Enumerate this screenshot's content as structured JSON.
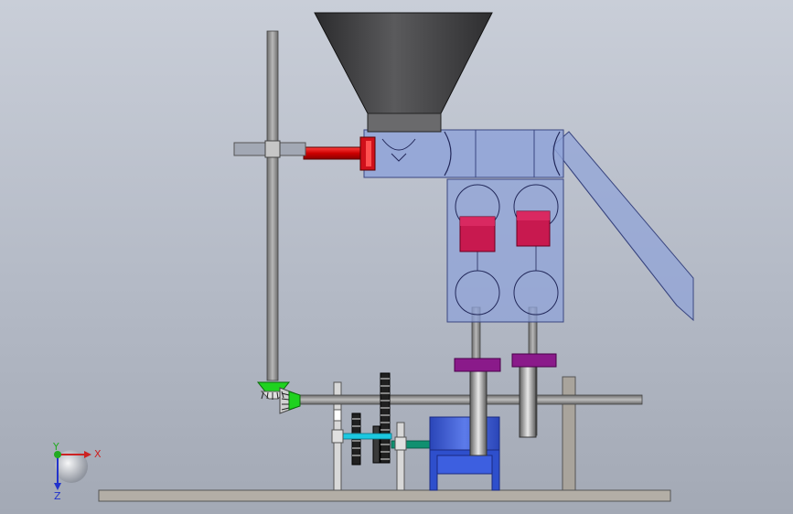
{
  "colors": {
    "background_top": "#c9ced8",
    "background_bottom": "#a3a9b5",
    "hopper": "#3c3c3e",
    "housing_glass": "#8fa3d8",
    "piston": "#c8194f",
    "rod_red": "#cc0000",
    "gear_green": "#22cc22",
    "crank_purple": "#8a1a8a",
    "motor_blue": "#3a5bd6",
    "shaft_cyan": "#1cc8e0",
    "shaft_teal": "#109070",
    "frame_gray": "#8e8b86",
    "axis_x": "#cc2222",
    "axis_y": "#22aa22",
    "axis_z": "#2233cc"
  },
  "axis_triad": {
    "x_label": "X",
    "y_label": "Y",
    "z_label": "Z"
  },
  "parts": [
    "hopper",
    "feed-housing",
    "piston-chamber",
    "piston-left",
    "piston-right",
    "discharge-chute",
    "vertical-transmission-shaft",
    "bevel-gear-pair",
    "horizontal-main-shaft",
    "spur-gear-train",
    "motor",
    "crank-disk-left",
    "crank-disk-right",
    "base-plate"
  ]
}
